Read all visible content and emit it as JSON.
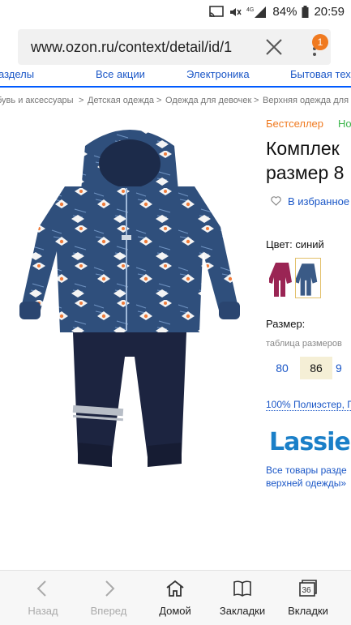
{
  "status": {
    "time": "20:59",
    "battery": "84%"
  },
  "browser": {
    "url": "www.ozon.ru/context/detail/id/1",
    "menu_badge": "1"
  },
  "nav": {
    "items": [
      "азделы",
      "Все акции",
      "Электроника",
      "Бытовая техн"
    ]
  },
  "breadcrumbs": [
    "бувь и аксессуары",
    ">",
    "Детская одежда",
    ">",
    "Одежда для девочек",
    ">",
    "Верхняя одежда для д"
  ],
  "product": {
    "tags": [
      "Бестселлер",
      "Но"
    ],
    "title_lines": [
      "Комплек",
      "размер 8"
    ],
    "favorite": "В избранное",
    "color_label": "Цвет: синий",
    "size_label": "Размер:",
    "size_table": "таблица размеров",
    "sizes": [
      "80",
      "86",
      "9"
    ],
    "selected_size": "86",
    "material": "100% Полиэстер, П",
    "brand": "Lassie",
    "brand_links": [
      "Все товары разде",
      "верхней одежды»"
    ]
  },
  "bottom_nav": {
    "items": [
      {
        "label": "Назад",
        "icon": "back-chevron-icon",
        "enabled": false
      },
      {
        "label": "Вперед",
        "icon": "forward-chevron-icon",
        "enabled": false
      },
      {
        "label": "Домой",
        "icon": "home-icon",
        "enabled": true
      },
      {
        "label": "Закладки",
        "icon": "bookmarks-book-icon",
        "enabled": true
      },
      {
        "label": "Вкладки",
        "icon": "tabs-icon",
        "enabled": true,
        "count": "36"
      }
    ]
  },
  "colors": {
    "link": "#1b57c7",
    "bestseller": "#f07a20",
    "new": "#3bb54a",
    "brand": "#1a7fc8"
  }
}
